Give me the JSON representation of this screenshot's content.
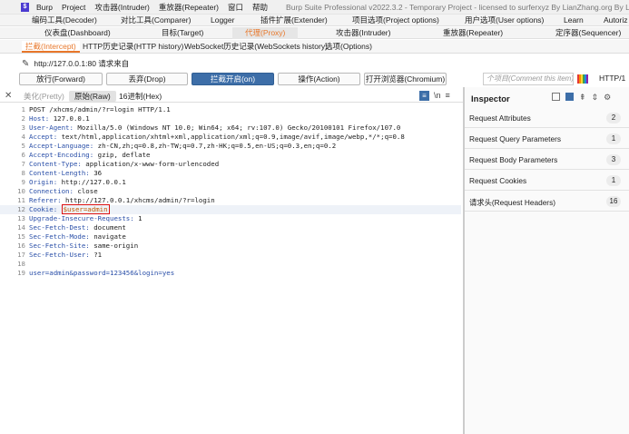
{
  "titlebar": {
    "logo": "$",
    "menu": [
      "Burp",
      "Project",
      "攻击器(Intruder)",
      "重放器(Repeater)",
      "窗口",
      "帮助"
    ],
    "title": "Burp Suite Professional v2022.3.2 - Temporary Project - licensed to surferxyz By LianZhang.org By LianZhang..."
  },
  "top_tabs_row1": [
    "编码工具(Decoder)",
    "对比工具(Comparer)",
    "Logger",
    "插件扩展(Extender)",
    "项目选项(Project options)",
    "用户选项(User options)",
    "Learn",
    "Autoriz"
  ],
  "top_tabs_row2": [
    "仪表盘(Dashboard)",
    "目标(Target)",
    "代理(Proxy)",
    "攻击器(Intruder)",
    "重放器(Repeater)",
    "定序器(Sequencer)"
  ],
  "sub_tabs": [
    "拦截(Intercept)",
    "HTTP历史记录(HTTP history)",
    "WebSocket历史记录(WebSockets history)",
    "选项(Options)"
  ],
  "request_url": "http://127.0.0.1:80 请求来自",
  "toolbar": {
    "forward": "放行(Forward)",
    "drop": "丢弃(Drop)",
    "intercept_on": "拦截开启(on)",
    "action": "操作(Action)",
    "open_browser": "打开浏览器(Chromium)",
    "comment_placeholder": "个项目(Comment this item)",
    "protocol": "HTTP/1"
  },
  "editor_tabs": {
    "pretty": "美化(Pretty)",
    "raw": "原始(Raw)",
    "hex": "16进制(Hex)",
    "newline_toggle": "\\n"
  },
  "request_lines": [
    {
      "n": "1",
      "name": "POST /xhcms/admin/?r=login HTTP/1.1",
      "value": ""
    },
    {
      "n": "2",
      "name": "Host:",
      "value": " 127.0.0.1"
    },
    {
      "n": "3",
      "name": "User-Agent:",
      "value": " Mozilla/5.0 (Windows NT 10.0; Win64; x64; rv:107.0) Gecko/20100101 Firefox/107.0"
    },
    {
      "n": "4",
      "name": "Accept:",
      "value": " text/html,application/xhtml+xml,application/xml;q=0.9,image/avif,image/webp,*/*;q=0.8"
    },
    {
      "n": "5",
      "name": "Accept-Language:",
      "value": " zh-CN,zh;q=0.8,zh-TW;q=0.7,zh-HK;q=0.5,en-US;q=0.3,en;q=0.2"
    },
    {
      "n": "6",
      "name": "Accept-Encoding:",
      "value": " gzip, deflate"
    },
    {
      "n": "7",
      "name": "Content-Type:",
      "value": " application/x-www-form-urlencoded"
    },
    {
      "n": "8",
      "name": "Content-Length:",
      "value": " 36"
    },
    {
      "n": "9",
      "name": "Origin:",
      "value": " http://127.0.0.1"
    },
    {
      "n": "10",
      "name": "Connection:",
      "value": " close"
    },
    {
      "n": "11",
      "name": "Referer:",
      "value": " http://127.0.0.1/xhcms/admin/?r=login"
    },
    {
      "n": "12",
      "name": "Cookie:",
      "value": "$user=admin"
    },
    {
      "n": "13",
      "name": "Upgrade-Insecure-Requests:",
      "value": " 1"
    },
    {
      "n": "14",
      "name": "Sec-Fetch-Dest:",
      "value": " document"
    },
    {
      "n": "15",
      "name": "Sec-Fetch-Mode:",
      "value": " navigate"
    },
    {
      "n": "16",
      "name": "Sec-Fetch-Site:",
      "value": " same-origin"
    },
    {
      "n": "17",
      "name": "Sec-Fetch-User:",
      "value": " ?1"
    },
    {
      "n": "18",
      "name": "",
      "value": ""
    },
    {
      "n": "19",
      "name": "",
      "value": "user=admin&password=123456&login=yes"
    }
  ],
  "inspector": {
    "title": "Inspector",
    "rows": [
      {
        "label": "Request Attributes",
        "count": "2"
      },
      {
        "label": "Request Query Parameters",
        "count": "1"
      },
      {
        "label": "Request Body Parameters",
        "count": "3"
      },
      {
        "label": "Request Cookies",
        "count": "1"
      },
      {
        "label": "请求头(Request Headers)",
        "count": "16"
      }
    ]
  },
  "colors": {
    "accent": "#e8772a",
    "primary_button": "#3d6ea8",
    "highlight_box": "#dd1111"
  }
}
